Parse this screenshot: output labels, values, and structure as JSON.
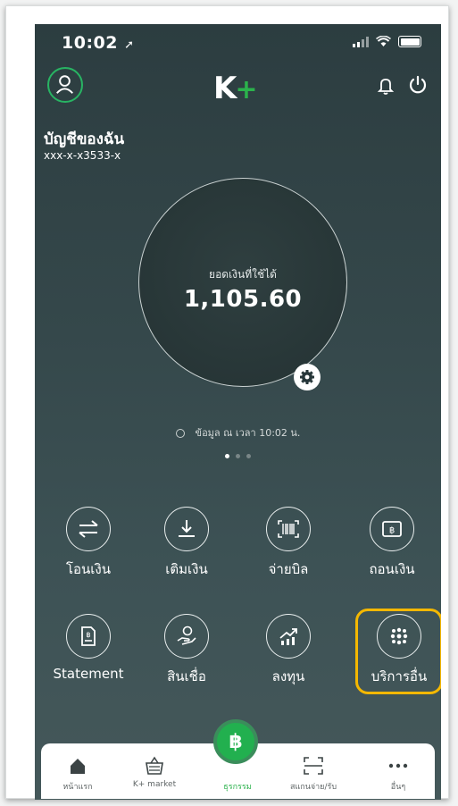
{
  "status_bar": {
    "time": "10:02"
  },
  "header": {
    "logo_text": "K",
    "logo_plus": "+"
  },
  "account": {
    "name": "บัญชีของฉัน",
    "number": "xxx-x-x3533-x"
  },
  "balance": {
    "label": "ยอดเงินที่ใช้ได้",
    "value": "1,105.60"
  },
  "updated_text": "ข้อมูล ณ เวลา 10:02 น.",
  "pager": {
    "count": 3,
    "active": 0
  },
  "actions": [
    {
      "label": "โอนเงิน",
      "icon": "transfer-icon"
    },
    {
      "label": "เติมเงิน",
      "icon": "topup-icon"
    },
    {
      "label": "จ่ายบิล",
      "icon": "barcode-icon"
    },
    {
      "label": "ถอนเงิน",
      "icon": "withdraw-icon"
    },
    {
      "label": "Statement",
      "icon": "statement-icon"
    },
    {
      "label": "สินเชื่อ",
      "icon": "loan-icon"
    },
    {
      "label": "ลงทุน",
      "icon": "invest-icon"
    },
    {
      "label": "บริการอื่น",
      "icon": "more-services-icon"
    }
  ],
  "tabs": [
    {
      "label": "หน้าแรก",
      "icon": "home-icon"
    },
    {
      "label": "K+ market",
      "icon": "basket-icon"
    },
    {
      "label": "ธุรกรรม",
      "icon": "baht-icon"
    },
    {
      "label": "สแกนจ่าย/รับ",
      "icon": "scan-icon"
    },
    {
      "label": "อื่นๆ",
      "icon": "more-icon"
    }
  ],
  "center_symbol": "฿",
  "colors": {
    "accent_green": "#2bb24c",
    "highlight": "#f5b800"
  }
}
